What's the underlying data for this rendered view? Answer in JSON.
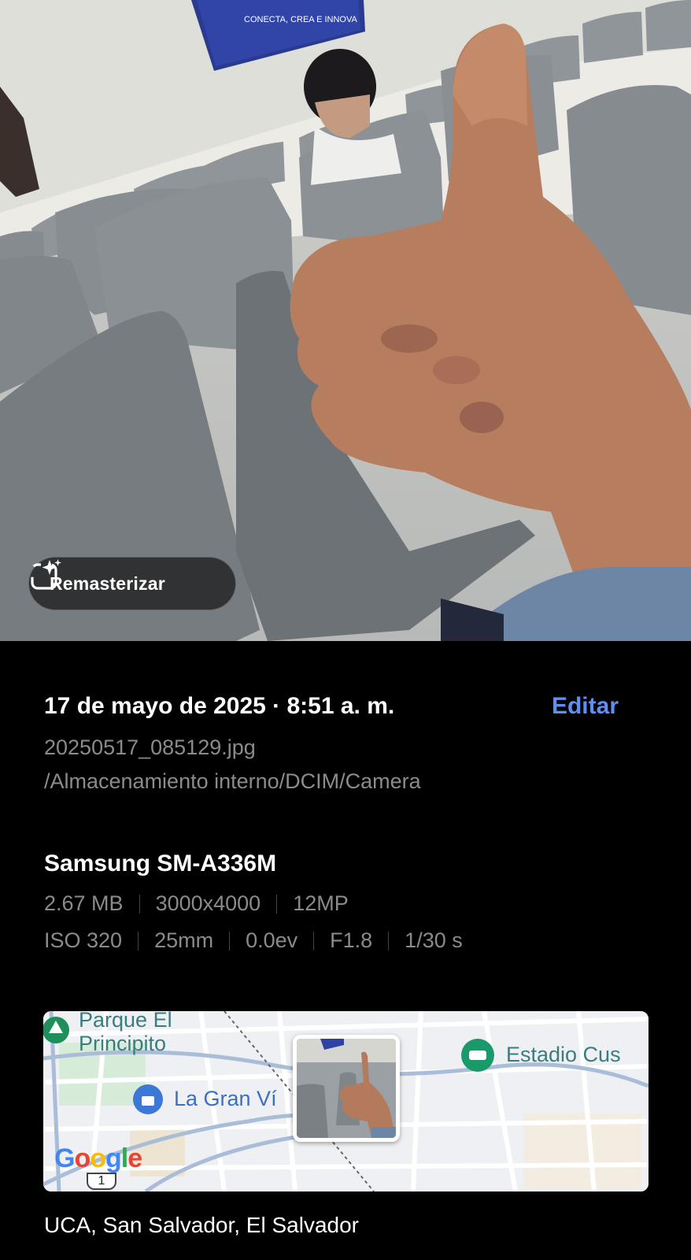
{
  "photo": {
    "projector_text_1": "CONECTA, CREA E INNOVA",
    "remaster_label": "Remasterizar",
    "remaster_icon": "sparkle-frame-icon"
  },
  "details": {
    "datetime": "17 de mayo de 2025 · 8:51 a. m.",
    "edit_label": "Editar",
    "filename": "20250517_085129.jpg",
    "path": "/Almacenamiento interno/DCIM/Camera",
    "device": "Samsung SM-A336M",
    "specs": {
      "size": "2.67 MB",
      "resolution": "3000x4000",
      "megapixels": "12MP",
      "iso": "ISO 320",
      "focal": "25mm",
      "ev": "0.0ev",
      "aperture": "F1.8",
      "shutter": "1/30 s"
    }
  },
  "map": {
    "poi_park": "Parque El Principito",
    "poi_park_line1": "Parque El",
    "poi_park_line2": "Principito",
    "poi_mall": "La Gran Ví",
    "poi_stadium": "Estadio Cus",
    "google": "Google",
    "road_number": "1",
    "accent_park": "#1e8e5a",
    "accent_mall": "#3c78d8",
    "accent_stadium": "#1a9a6a"
  },
  "location": "UCA, San Salvador, El Salvador"
}
